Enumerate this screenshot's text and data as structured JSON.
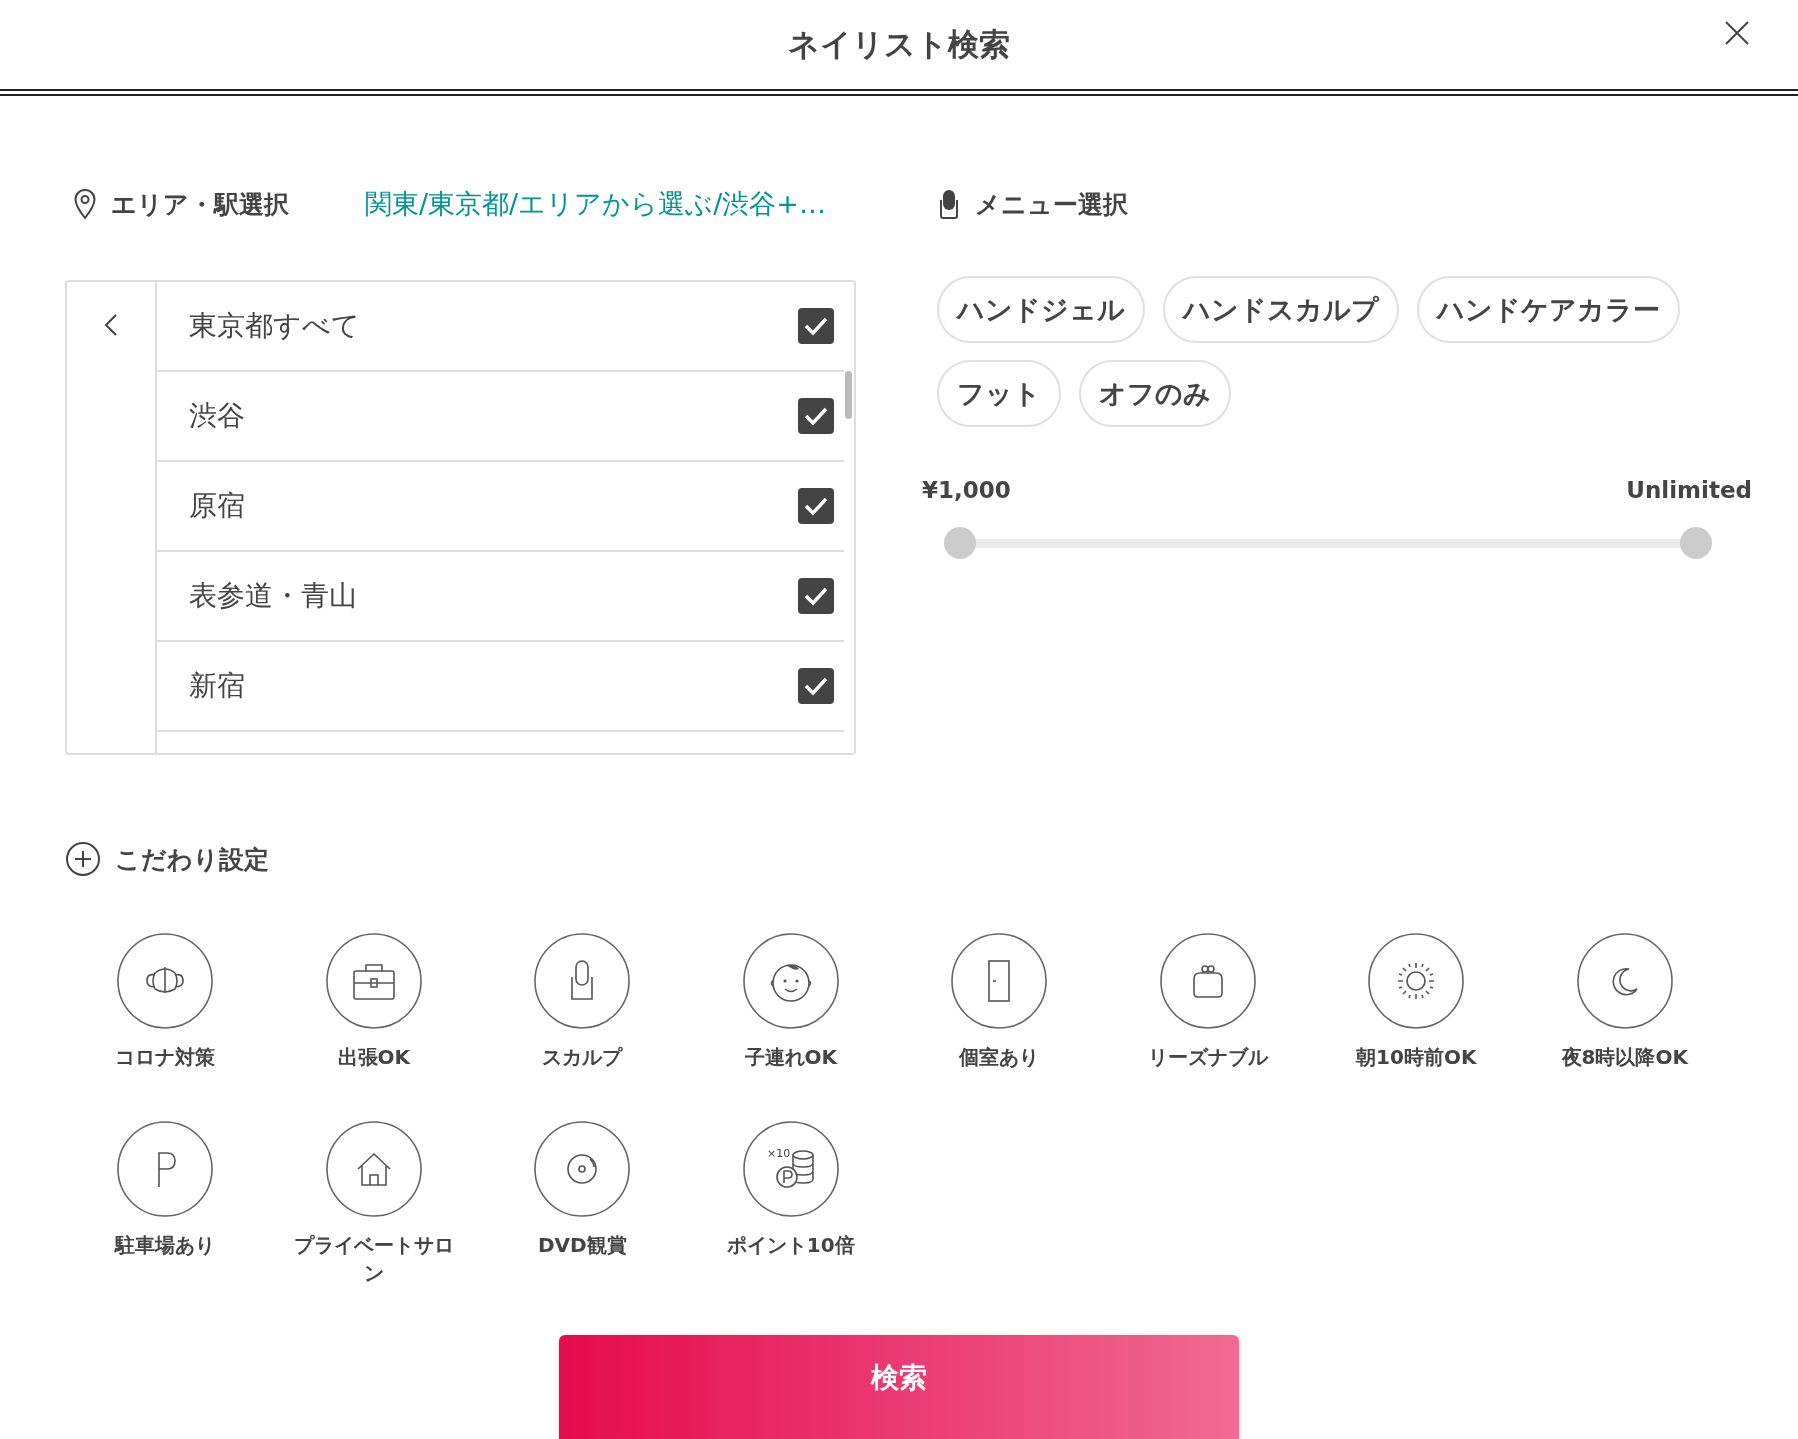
{
  "window": {
    "title": "ネイリスト検索"
  },
  "area": {
    "label": "エリア・駅選択",
    "link": "関東/東京都/エリアから選ぶ/渋谷+…",
    "list": {
      "items": [
        {
          "label": "東京都すべて",
          "checked": true
        },
        {
          "label": "渋谷",
          "checked": true
        },
        {
          "label": "原宿",
          "checked": true
        },
        {
          "label": "表参道・青山",
          "checked": true
        },
        {
          "label": "新宿",
          "checked": true
        }
      ]
    }
  },
  "menu": {
    "label": "メニュー選択",
    "chips": [
      {
        "label": "ハンドジェル",
        "selected": false
      },
      {
        "label": "ハンドスカルプ",
        "selected": false
      },
      {
        "label": "ハンドケアカラー",
        "selected": false
      },
      {
        "label": "フット",
        "selected": false
      },
      {
        "label": "オフのみ",
        "selected": false
      }
    ],
    "price": {
      "min_label": "¥1,000",
      "max_label": "Unlimited",
      "thumbs": [
        {
          "level": 0
        },
        {
          "level": 1
        }
      ]
    }
  },
  "preferences": {
    "label": "こだわり設定",
    "items": [
      {
        "kind": "mask",
        "label": "コロナ対策"
      },
      {
        "kind": "briefcase",
        "label": "出張OK"
      },
      {
        "kind": "nail",
        "label": "スカルプ"
      },
      {
        "kind": "baby",
        "label": "子連れOK"
      },
      {
        "kind": "door",
        "label": "個室あり"
      },
      {
        "kind": "purse",
        "label": "リーズナブル"
      },
      {
        "kind": "sun",
        "label": "朝10時前OK"
      },
      {
        "kind": "moon",
        "label": "夜8時以降OK"
      },
      {
        "kind": "parking",
        "label": "駐車場あり"
      },
      {
        "kind": "house",
        "label": "プライベートサロン"
      },
      {
        "kind": "disc",
        "label": "DVD観賞"
      },
      {
        "kind": "points",
        "label": "ポイント10倍",
        "badge": "×10"
      }
    ]
  },
  "search_button": "検索"
}
